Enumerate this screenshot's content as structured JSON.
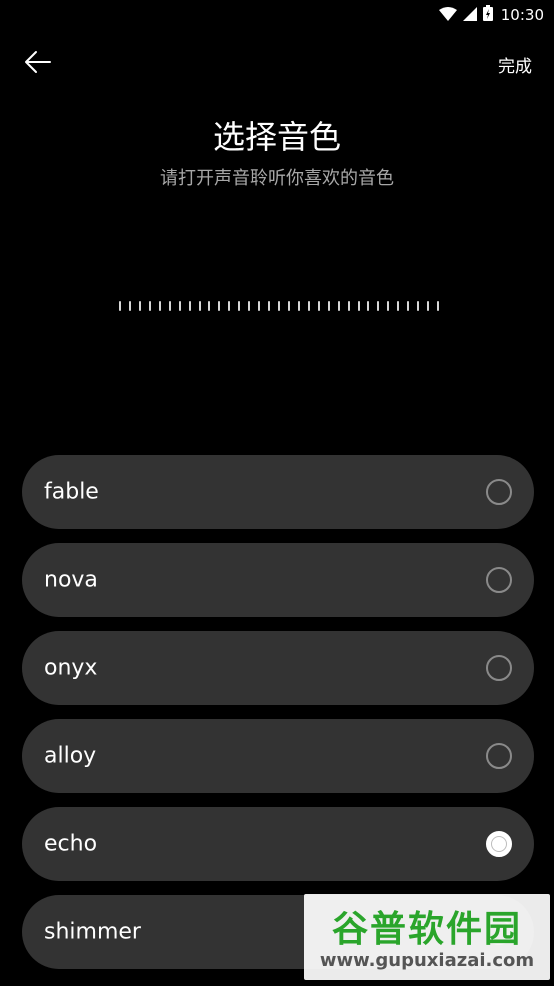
{
  "status_bar": {
    "time": "10:30",
    "icons": [
      "wifi-icon",
      "signal-icon",
      "battery-icon"
    ]
  },
  "header": {
    "back_icon": "arrow-left-icon",
    "done_label": "完成"
  },
  "title": "选择音色",
  "subtitle": "请打开声音聆听你喜欢的音色",
  "waveform": {
    "tick_count": 33
  },
  "voices": [
    {
      "name": "fable",
      "selected": false
    },
    {
      "name": "nova",
      "selected": false
    },
    {
      "name": "onyx",
      "selected": false
    },
    {
      "name": "alloy",
      "selected": false
    },
    {
      "name": "echo",
      "selected": true
    },
    {
      "name": "shimmer",
      "selected": false
    }
  ],
  "watermark": {
    "text": "谷普软件园",
    "url": "www.gupuxiazai.com"
  },
  "colors": {
    "background": "#000000",
    "item_bg": "#333333",
    "subtitle": "#a7a7a7",
    "watermark_green": "#2aa52b"
  }
}
